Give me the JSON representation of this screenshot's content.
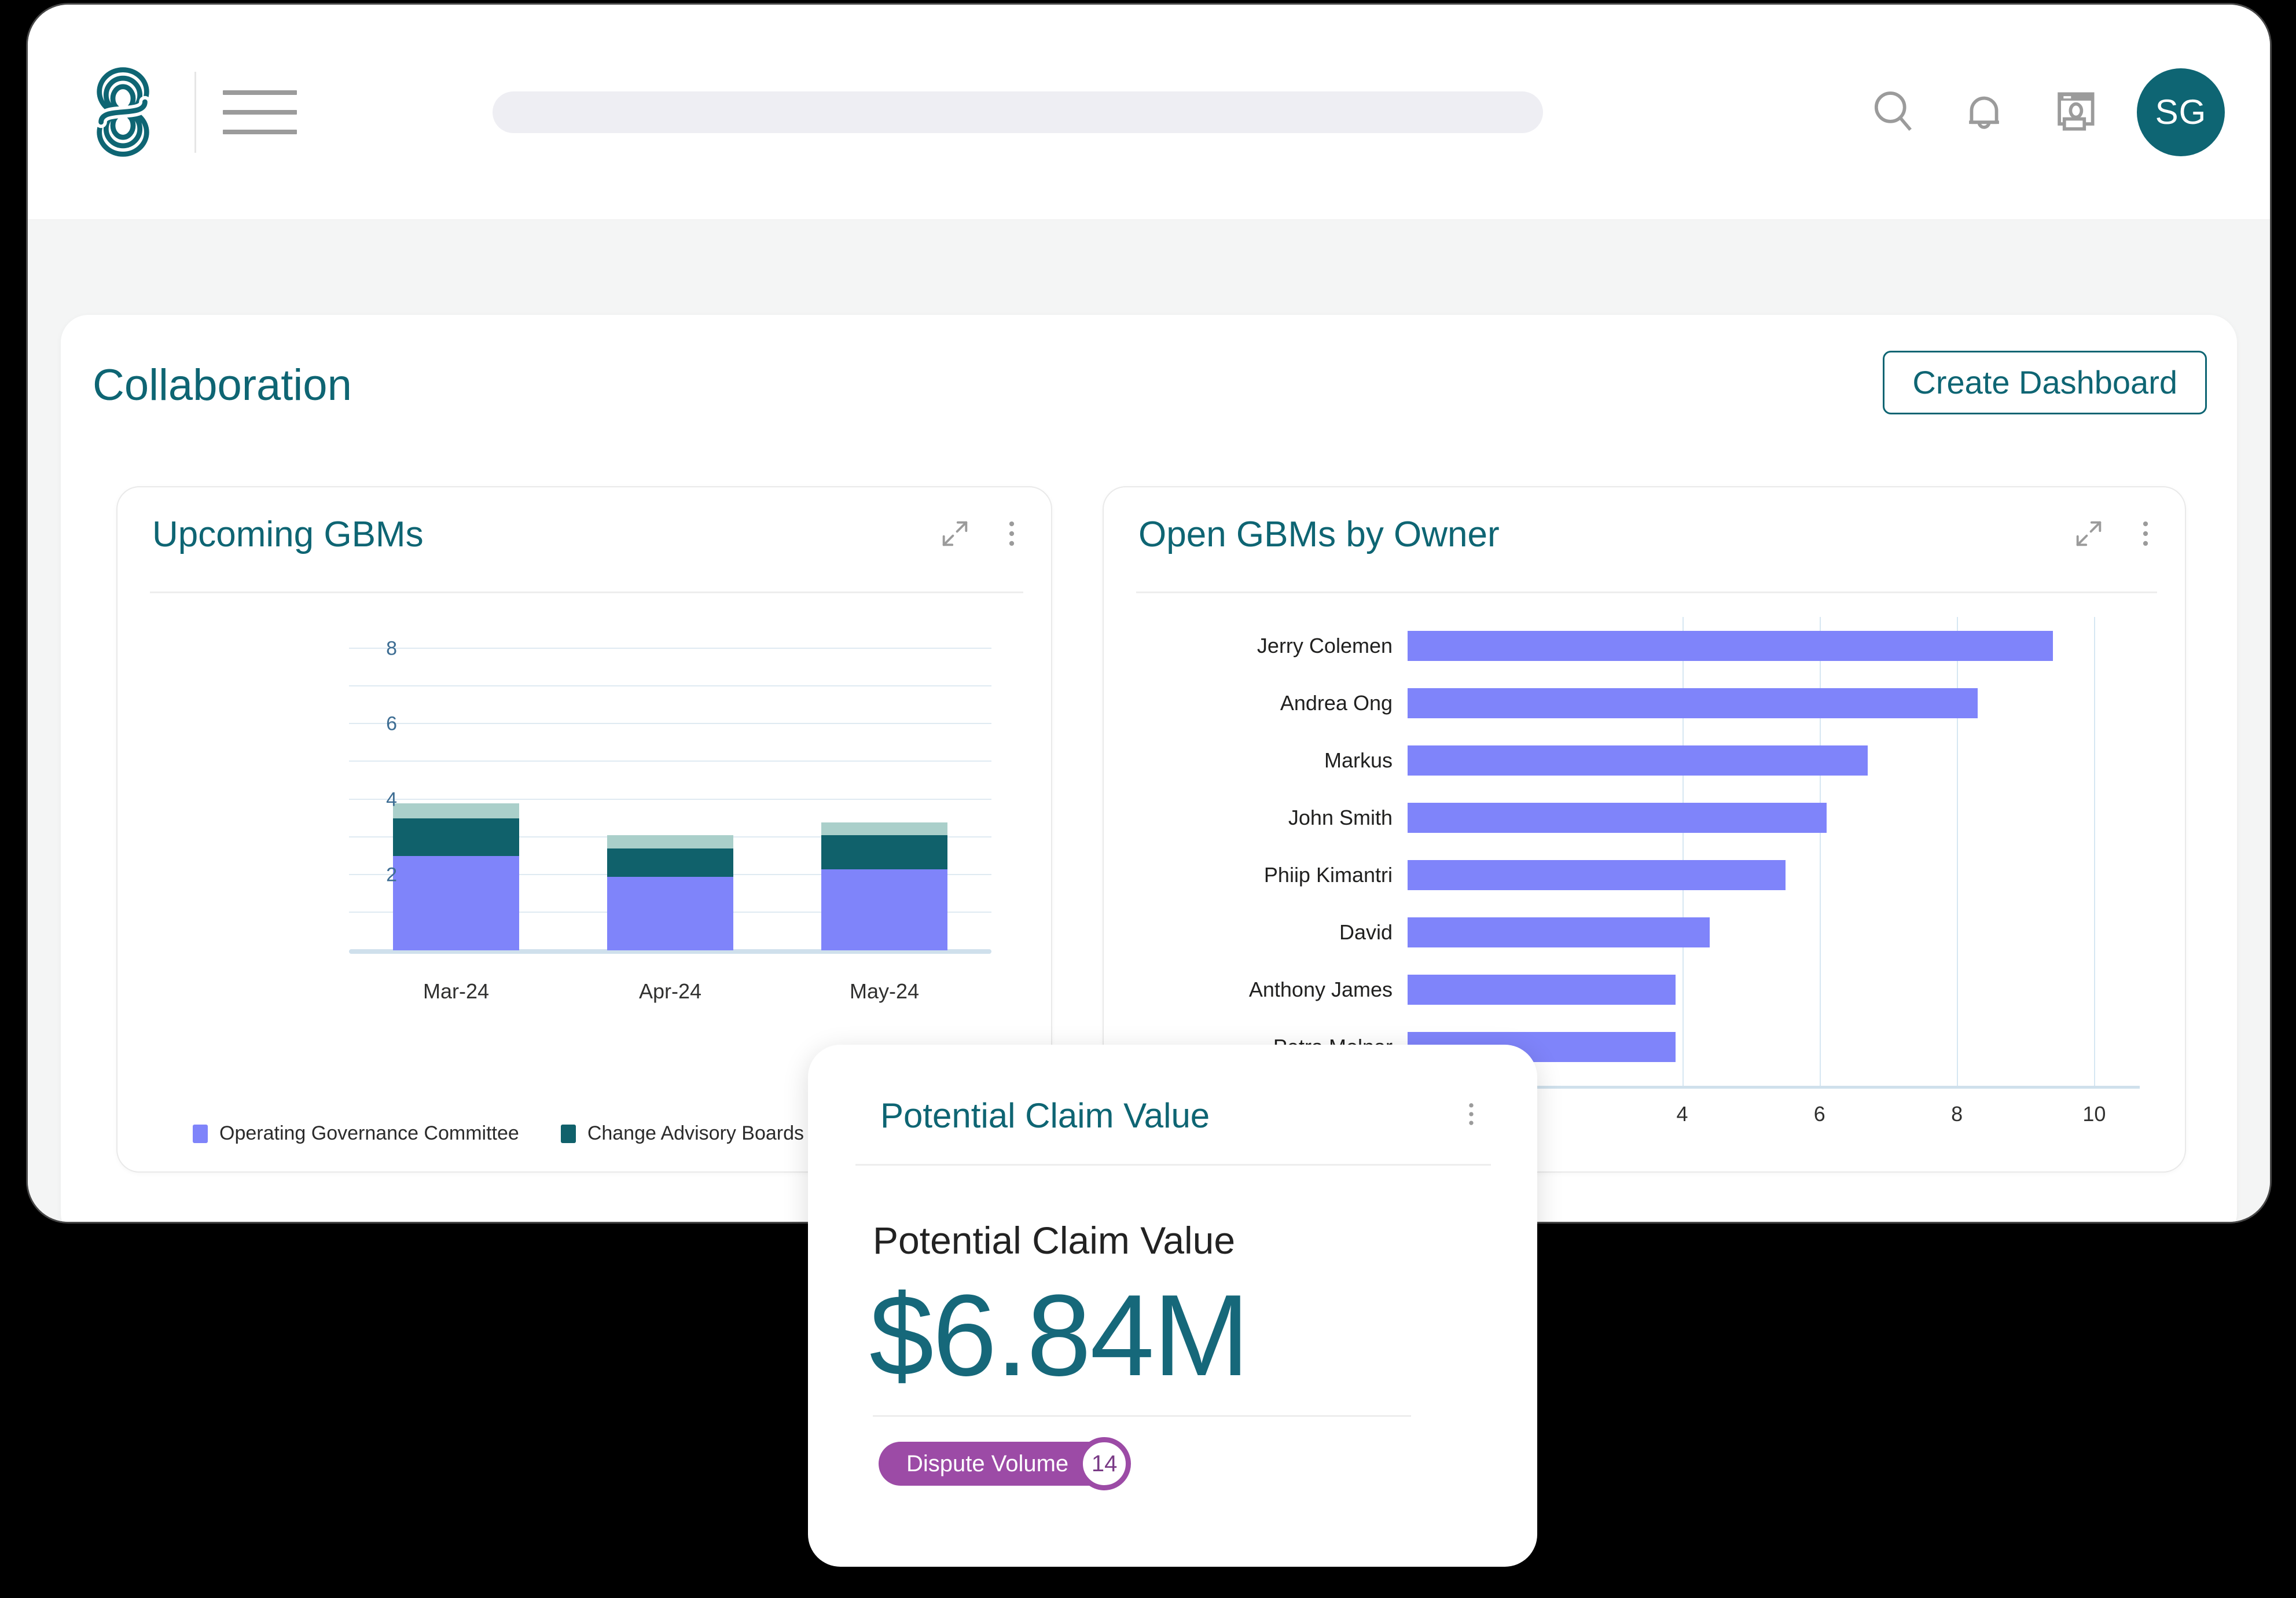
{
  "header": {
    "logo_icon": "brand-logo-icon",
    "menu_icon": "hamburger-menu-icon",
    "search": {
      "value": "",
      "placeholder": ""
    },
    "icons": [
      {
        "name": "search-icon"
      },
      {
        "name": "notifications-bell-icon"
      },
      {
        "name": "presentation-user-icon"
      }
    ],
    "avatar_initials": "SG"
  },
  "collaboration": {
    "title": "Collaboration",
    "create_dashboard_label": "Create Dashboard"
  },
  "widgets": {
    "upcoming_gbms": {
      "title": "Upcoming GBMs",
      "expand_icon": "expand-diagonal-icon",
      "more_icon": "more-vertical-icon"
    },
    "open_gbms": {
      "title": "Open GBMs by Owner",
      "expand_icon": "expand-diagonal-icon",
      "more_icon": "more-vertical-icon"
    }
  },
  "kpi": {
    "card_title": "Potential Claim Value",
    "more_icon": "more-vertical-icon",
    "metric_label": "Potential Claim Value",
    "metric_value": "$6.84M",
    "pill_label": "Dispute Volume",
    "pill_count": "14",
    "pill_color": "#9c4ba6"
  },
  "colors": {
    "brand_teal": "#0E6573",
    "series_purple": "#7f84fa",
    "series_teal": "#10616b",
    "series_light_teal": "#aacfca",
    "value_teal": "#16687A",
    "page_bg": "#f4f5f5"
  },
  "chart_data": [
    {
      "type": "bar",
      "id": "upcoming-gbms",
      "title": "Upcoming GBMs",
      "stacked": true,
      "orientation": "vertical",
      "categories": [
        "Mar-24",
        "Apr-24",
        "May-24"
      ],
      "series": [
        {
          "name": "Operating Governance Committee",
          "color": "#7f84fa",
          "values": [
            2.5,
            1.95,
            2.15
          ]
        },
        {
          "name": "Change Advisory Boards",
          "color": "#10616b",
          "values": [
            1.0,
            0.75,
            0.9
          ]
        },
        {
          "name": "",
          "color": "#aacfca",
          "values": [
            0.4,
            0.35,
            0.35
          ]
        }
      ],
      "legend": [
        {
          "label": "Operating Governance Committee",
          "color": "#7f84fa"
        },
        {
          "label": "Change Advisory Boards",
          "color": "#10616b"
        }
      ],
      "legend_position": "bottom-left",
      "ylabel": "",
      "xlabel": "",
      "ylim": [
        0,
        8.6
      ],
      "yticks": [
        2,
        4,
        6,
        8
      ],
      "ytick_labels": [
        "2",
        "4",
        "6",
        "8"
      ],
      "ygridlines": [
        1,
        2,
        3,
        4,
        5,
        6,
        7,
        8
      ],
      "grid": true
    },
    {
      "type": "bar",
      "id": "open-gbms-by-owner",
      "title": "Open GBMs by Owner",
      "orientation": "horizontal",
      "categories": [
        "Jerry Colemen",
        "Andrea Ong",
        "Markus",
        "John Smith",
        "Phiip Kimantri",
        "David",
        "Anthony James",
        "Petra Molnar"
      ],
      "values": [
        9.4,
        8.3,
        6.7,
        6.1,
        5.5,
        4.4,
        3.9,
        3.9
      ],
      "color": "#7f84fa",
      "xlim": [
        0,
        11
      ],
      "xticks": [
        4,
        6,
        8,
        10
      ],
      "xtick_labels": [
        "4",
        "6",
        "8",
        "10"
      ],
      "xgridlines": [
        4,
        6,
        8,
        10
      ],
      "grid": true,
      "xlabel": "",
      "ylabel": ""
    }
  ]
}
